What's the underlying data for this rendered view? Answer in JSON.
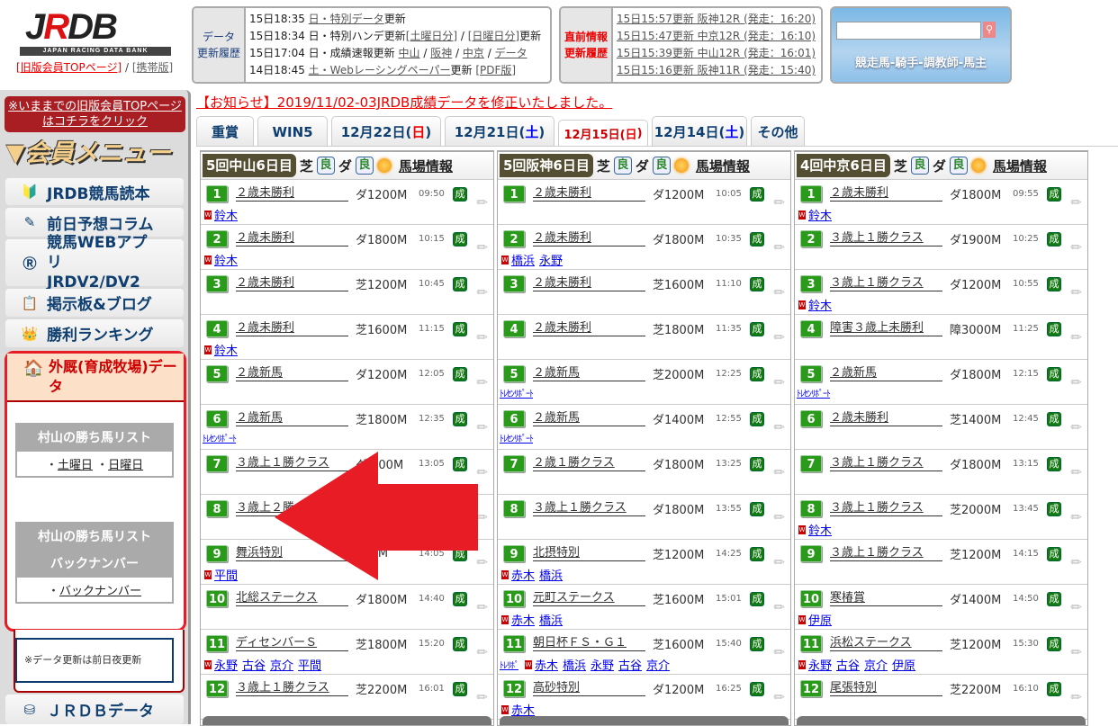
{
  "header": {
    "logo_text": "JRDB",
    "logo_sub": "JAPAN RACING DATA BANK",
    "old_top_link": "[旧版会員TOPページ]",
    "separator": " / ",
    "mobile_link": "[携帯版]"
  },
  "data_history": {
    "label_line1": "データ",
    "label_line2": "更新履歴",
    "lines": [
      {
        "time": "15日18:35 ",
        "parts": [
          {
            "t": "日・特別データ",
            "link": true
          },
          {
            "t": "更新",
            "link": false
          }
        ]
      },
      {
        "time": "15日18:34 ",
        "parts": [
          {
            "t": "日・特別ハンデ更新",
            "link": false
          },
          {
            "t": "[土曜日分]",
            "link": true
          },
          {
            "t": " / ",
            "link": false
          },
          {
            "t": "[日曜日分]",
            "link": true
          },
          {
            "t": "更新",
            "link": false
          }
        ]
      },
      {
        "time": "15日17:04 ",
        "parts": [
          {
            "t": "日・成績速報更新 ",
            "link": false
          },
          {
            "t": "中山",
            "link": true
          },
          {
            "t": " / ",
            "link": false
          },
          {
            "t": "阪神",
            "link": true
          },
          {
            "t": " / ",
            "link": false
          },
          {
            "t": "中京",
            "link": true
          },
          {
            "t": " / ",
            "link": false
          },
          {
            "t": "データ",
            "link": true
          }
        ]
      },
      {
        "time": "14日18:45 ",
        "parts": [
          {
            "t": "土・Webレーシングペーパー",
            "link": true
          },
          {
            "t": "更新 ",
            "link": false
          },
          {
            "t": "[PDF版]",
            "link": true
          }
        ]
      }
    ]
  },
  "latest_history": {
    "label_line1": "直前情報",
    "label_line2": "更新履歴",
    "lines": [
      "15日15:57更新 阪神12R (発走：16:20)",
      "15日15:47更新 中京12R (発走：16:10)",
      "15日15:39更新 中山12R (発走：16:01)",
      "15日15:16更新 阪神11R (発走：15:40)"
    ]
  },
  "search": {
    "value": "",
    "caption": "競走馬-騎手-調教師-馬主"
  },
  "sidebar": {
    "old_top_notice": "※いままでの旧版会員TOPページはコチラをクリック",
    "menu_title": "▼会員メニュー",
    "items": [
      {
        "label": "JRDB競馬読本",
        "icon": "beginner-leaf-icon"
      },
      {
        "label": "前日予想コラム",
        "icon": "pen-icon"
      },
      {
        "label": "競馬WEBアプリJRDV2/DV2",
        "icon": "app-j-icon"
      },
      {
        "label": "掲示板&ブログ",
        "icon": "clipboard-icon"
      },
      {
        "label": "勝利ランキング",
        "icon": "crown-icon"
      }
    ],
    "gaikyu_label": "外厩(育成牧場)データ",
    "winlist_title": "村山の勝ち馬リスト",
    "winlist_sat": "土曜日",
    "winlist_sun": "日曜日",
    "backnumber_title1": "村山の勝ち馬リスト",
    "backnumber_title2": "バックナンバー",
    "backnumber_link": "バックナンバー",
    "bullet": "・",
    "update_note": "※データ更新は前日夜更新",
    "jrdb_data": "ＪＲＤＢデータ"
  },
  "notice": "【お知らせ】2019/11/02-03JRDB成績データを修正いたしました。",
  "tabs": [
    {
      "label": "重賞"
    },
    {
      "label": "WIN5"
    },
    {
      "label": "12月22日(",
      "day": "日",
      "tail": ")",
      "kind": "sun"
    },
    {
      "label": "12月21日(",
      "day": "土",
      "tail": ")",
      "kind": "sat"
    },
    {
      "label": "12月15日(",
      "day": "日",
      "tail": ")",
      "kind": "sun",
      "active": true
    },
    {
      "label": "12月14日(",
      "day": "土",
      "tail": ")",
      "kind": "sat"
    },
    {
      "label": "その他"
    }
  ],
  "columns": [
    {
      "venue": "5回中山6日目",
      "turf": "芝",
      "turf_cond": "良",
      "dirt": "ダ",
      "dirt_cond": "良",
      "info": "馬場情報",
      "races": [
        {
          "no": "1",
          "name": "２歳未勝利",
          "dist": "ダ1200M",
          "time": "09:50",
          "links": [
            "鈴木"
          ]
        },
        {
          "no": "2",
          "name": "２歳未勝利",
          "dist": "ダ1800M",
          "time": "10:15",
          "links": [
            "鈴木"
          ]
        },
        {
          "no": "3",
          "name": "２歳未勝利",
          "dist": "芝1200M",
          "time": "10:45",
          "links": []
        },
        {
          "no": "4",
          "name": "２歳未勝利",
          "dist": "芝1600M",
          "time": "11:15",
          "links": [
            "鈴木"
          ]
        },
        {
          "no": "5",
          "name": "２歳新馬",
          "dist": "ダ1200M",
          "time": "12:05",
          "links": []
        },
        {
          "no": "6",
          "name": "２歳新馬",
          "dist": "芝1800M",
          "time": "12:35",
          "links": [],
          "trecen": "ﾄﾚｾﾝﾘﾎﾟｰﾄ"
        },
        {
          "no": "7",
          "name": "３歳上１勝クラス",
          "dist": "ダ 600M",
          "time": "13:05",
          "links": []
        },
        {
          "no": "8",
          "name": "３歳上２勝",
          "dist": "",
          "time": "",
          "links": []
        },
        {
          "no": "9",
          "name": "舞浜特別",
          "dist": "200M",
          "time": "14:05",
          "links": [
            "平間"
          ]
        },
        {
          "no": "10",
          "name": "北総ステークス",
          "dist": "ダ1800M",
          "time": "14:40",
          "links": []
        },
        {
          "no": "11",
          "name": "ディセンバーＳ",
          "dist": "芝1800M",
          "time": "15:20",
          "links": [
            "永野",
            "古谷",
            "京介",
            "平間"
          ]
        },
        {
          "no": "12",
          "name": "３歳上１勝クラス",
          "dist": "芝2200M",
          "time": "16:01",
          "links": []
        }
      ]
    },
    {
      "venue": "5回阪神6日目",
      "turf": "芝",
      "turf_cond": "良",
      "dirt": "ダ",
      "dirt_cond": "良",
      "info": "馬場情報",
      "races": [
        {
          "no": "1",
          "name": "２歳未勝利",
          "dist": "ダ1200M",
          "time": "10:05",
          "links": []
        },
        {
          "no": "2",
          "name": "２歳未勝利",
          "dist": "ダ1800M",
          "time": "10:35",
          "links": [
            "橋浜",
            "永野"
          ]
        },
        {
          "no": "3",
          "name": "２歳未勝利",
          "dist": "芝1600M",
          "time": "11:10",
          "links": []
        },
        {
          "no": "4",
          "name": "２歳未勝利",
          "dist": "芝1800M",
          "time": "11:35",
          "links": []
        },
        {
          "no": "5",
          "name": "２歳新馬",
          "dist": "芝2000M",
          "time": "12:25",
          "links": [],
          "trecen": "ﾄﾚｾﾝﾘﾎﾟｰﾄ"
        },
        {
          "no": "6",
          "name": "２歳新馬",
          "dist": "ダ1400M",
          "time": "12:55",
          "links": [],
          "trecen": "ﾄﾚｾﾝﾘﾎﾟｰﾄ"
        },
        {
          "no": "7",
          "name": "２歳１勝クラス",
          "dist": "ダ1800M",
          "time": "13:25",
          "links": []
        },
        {
          "no": "8",
          "name": "３歳上１勝クラス",
          "dist": "ダ1800M",
          "time": "13:55",
          "links": []
        },
        {
          "no": "9",
          "name": "北摂特別",
          "dist": "芝1200M",
          "time": "14:25",
          "links": [
            "赤木",
            "橋浜"
          ]
        },
        {
          "no": "10",
          "name": "元町ステークス",
          "dist": "芝1600M",
          "time": "15:01",
          "links": [
            "赤木",
            "橋浜"
          ]
        },
        {
          "no": "11",
          "name": "朝日杯ＦＳ・Ｇ１",
          "dist": "芝1600M",
          "time": "15:40",
          "links": [
            "赤木",
            "橋浜",
            "永野",
            "古谷",
            "京介"
          ],
          "trecen_short": "ﾄﾚﾘﾎﾟ"
        },
        {
          "no": "12",
          "name": "高砂特別",
          "dist": "ダ1200M",
          "time": "16:25",
          "links": [
            "赤木"
          ]
        }
      ]
    },
    {
      "venue": "4回中京6日目",
      "turf": "芝",
      "turf_cond": "良",
      "dirt": "ダ",
      "dirt_cond": "良",
      "info": "馬場情報",
      "races": [
        {
          "no": "1",
          "name": "２歳未勝利",
          "dist": "ダ1800M",
          "time": "09:55",
          "links": [
            "鈴木"
          ]
        },
        {
          "no": "2",
          "name": "３歳上１勝クラス",
          "dist": "ダ1900M",
          "time": "10:25",
          "links": []
        },
        {
          "no": "3",
          "name": "３歳上１勝クラス",
          "dist": "ダ1200M",
          "time": "10:55",
          "links": [
            "鈴木"
          ]
        },
        {
          "no": "4",
          "name": "障害３歳上未勝利",
          "dist": "障3000M",
          "time": "11:25",
          "links": []
        },
        {
          "no": "5",
          "name": "２歳新馬",
          "dist": "ダ1800M",
          "time": "12:15",
          "links": [],
          "trecen": "ﾄﾚｾﾝﾘﾎﾟｰﾄ"
        },
        {
          "no": "6",
          "name": "２歳未勝利",
          "dist": "芝1400M",
          "time": "12:45",
          "links": []
        },
        {
          "no": "7",
          "name": "３歳上１勝クラス",
          "dist": "ダ1800M",
          "time": "13:15",
          "links": []
        },
        {
          "no": "8",
          "name": "３歳上１勝クラス",
          "dist": "芝2000M",
          "time": "13:45",
          "links": [
            "鈴木"
          ]
        },
        {
          "no": "9",
          "name": "３歳上１勝クラス",
          "dist": "芝1200M",
          "time": "14:15",
          "links": []
        },
        {
          "no": "10",
          "name": "寒椿賞",
          "dist": "ダ1400M",
          "time": "14:50",
          "links": [
            "伊原"
          ]
        },
        {
          "no": "11",
          "name": "浜松ステークス",
          "dist": "芝1200M",
          "time": "15:30",
          "links": [
            "永野",
            "古谷",
            "京介",
            "伊原"
          ]
        },
        {
          "no": "12",
          "name": "尾張特別",
          "dist": "芝2200M",
          "time": "16:10",
          "links": []
        }
      ]
    }
  ],
  "result_badge": "成",
  "colors": {
    "accent_red": "#e81c24",
    "race_green": "#2a9a1a",
    "venue_bg": "#544e33",
    "menu_blue": "#0f3f70"
  }
}
